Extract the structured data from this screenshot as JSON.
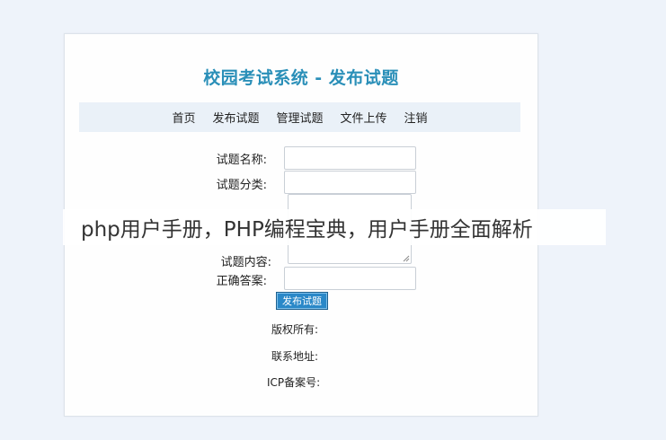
{
  "page": {
    "title": "校园考试系统 - 发布试题"
  },
  "nav": {
    "items": [
      "首页",
      "发布试题",
      "管理试题",
      "文件上传",
      "注销"
    ]
  },
  "form": {
    "name_label": "试题名称:",
    "category_label": "试题分类:",
    "content_label": "试题内容:",
    "answer_label": "正确答案:",
    "name_value": "",
    "category_value": "",
    "content_value": "",
    "answer_value": "",
    "submit_label": "发布试题"
  },
  "footer": {
    "copyright_label": "版权所有:",
    "address_label": "联系地址:",
    "icp_label": "ICP备案号:"
  },
  "overlay": {
    "text": "php用户手册，PHP编程宝典，用户手册全面解析"
  },
  "colors": {
    "title": "#2a8fb8",
    "nav_bg": "#eaf1f8",
    "button": "#2a88c8",
    "page_bg": "#eef3fa"
  }
}
